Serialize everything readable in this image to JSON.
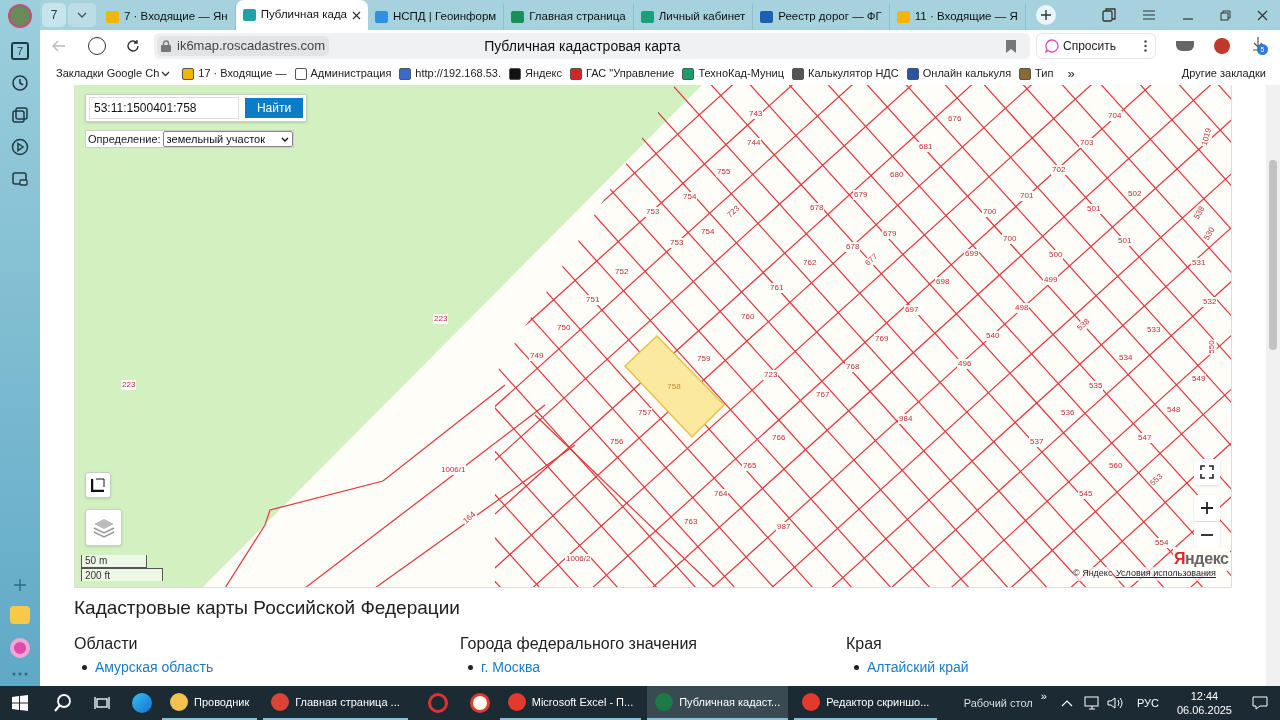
{
  "sidebar": {
    "counter": "7"
  },
  "tab_bar": {
    "counter": "7"
  },
  "tabs": [
    {
      "label": "7 · Входящие — Ян",
      "selected": false
    },
    {
      "label": "Публичная када",
      "selected": true
    },
    {
      "label": "НСПД | Геоинформ",
      "selected": false
    },
    {
      "label": "Главная страница",
      "selected": false
    },
    {
      "label": "Личный кабинет",
      "selected": false
    },
    {
      "label": "Реестр дорог — ФГ",
      "selected": false
    },
    {
      "label": "11 · Входящие — Я",
      "selected": false
    }
  ],
  "address_bar": {
    "url": "ik6map.roscadastres.com",
    "page_title": "Публичная кадастровая карта",
    "ask_button": "Спросить",
    "downloads_badge": "5"
  },
  "bookmarks": [
    "Закладки Google Ch",
    "17 · Входящие — ",
    "Администрация",
    "http://192.168.53.",
    "Яндекс",
    "ГАС \"Управление",
    "ТехноКад-Муниц",
    "Калькулятор НДС",
    "Онлайн калькуля",
    "Тип"
  ],
  "bookmarks_more": "»",
  "other_bookmarks": "Другие закладки",
  "map": {
    "search_value": "53:11:1500401:758",
    "search_button": "Найти",
    "mode_label": "Определение:",
    "mode_value": "земельный участок",
    "selected_parcel": "758",
    "parcel_labels": [
      "743",
      "676",
      "704",
      "744",
      "681",
      "703",
      "755",
      "680",
      "702",
      "502",
      "754",
      "679",
      "701",
      "501",
      "753",
      "678",
      "723",
      "700",
      "501",
      "754",
      "753",
      "679",
      "700",
      "678",
      "677",
      "762",
      "699",
      "500",
      "531",
      "752",
      "761",
      "698",
      "499",
      "751",
      "532",
      "760",
      "697",
      "498",
      "538",
      "223",
      "750",
      "540",
      "533",
      "749",
      "759",
      "769",
      "534",
      "550",
      "223",
      "768",
      "496",
      "549",
      "723",
      "535",
      "757",
      "767",
      "536",
      "548",
      "984",
      "756",
      "766",
      "537",
      "547",
      "1006/1",
      "765",
      "560",
      "764",
      "545",
      "164",
      "763",
      "987",
      "1006/2",
      "554",
      "553",
      "538",
      "530",
      "1019"
    ],
    "scale": [
      "50 m",
      "200 ft"
    ],
    "logo": "Яндекс",
    "copyright": "© Яндекс",
    "terms_link": "Условия использования"
  },
  "catalog": {
    "title": "Кадастровые карты Российской Федерации",
    "columns": [
      {
        "heading": "Области",
        "items": [
          "Амурская область"
        ]
      },
      {
        "heading": "Города федерального значения",
        "items": [
          "г. Москва"
        ]
      },
      {
        "heading": "Края",
        "items": [
          "Алтайский край"
        ]
      }
    ]
  },
  "taskbar": {
    "apps": [
      {
        "label": "Проводник",
        "active": false
      },
      {
        "label": "Главная страница ...",
        "active": false
      },
      {
        "label": "Microsoft Excel - П...",
        "active": false
      },
      {
        "label": "Публичная кадаст...",
        "active": true
      },
      {
        "label": "Редактор скриншо...",
        "active": false
      }
    ],
    "desktop": "Рабочий стол",
    "more": "»",
    "language": "РУС",
    "time": "12:44",
    "date": "06.06.2025"
  }
}
